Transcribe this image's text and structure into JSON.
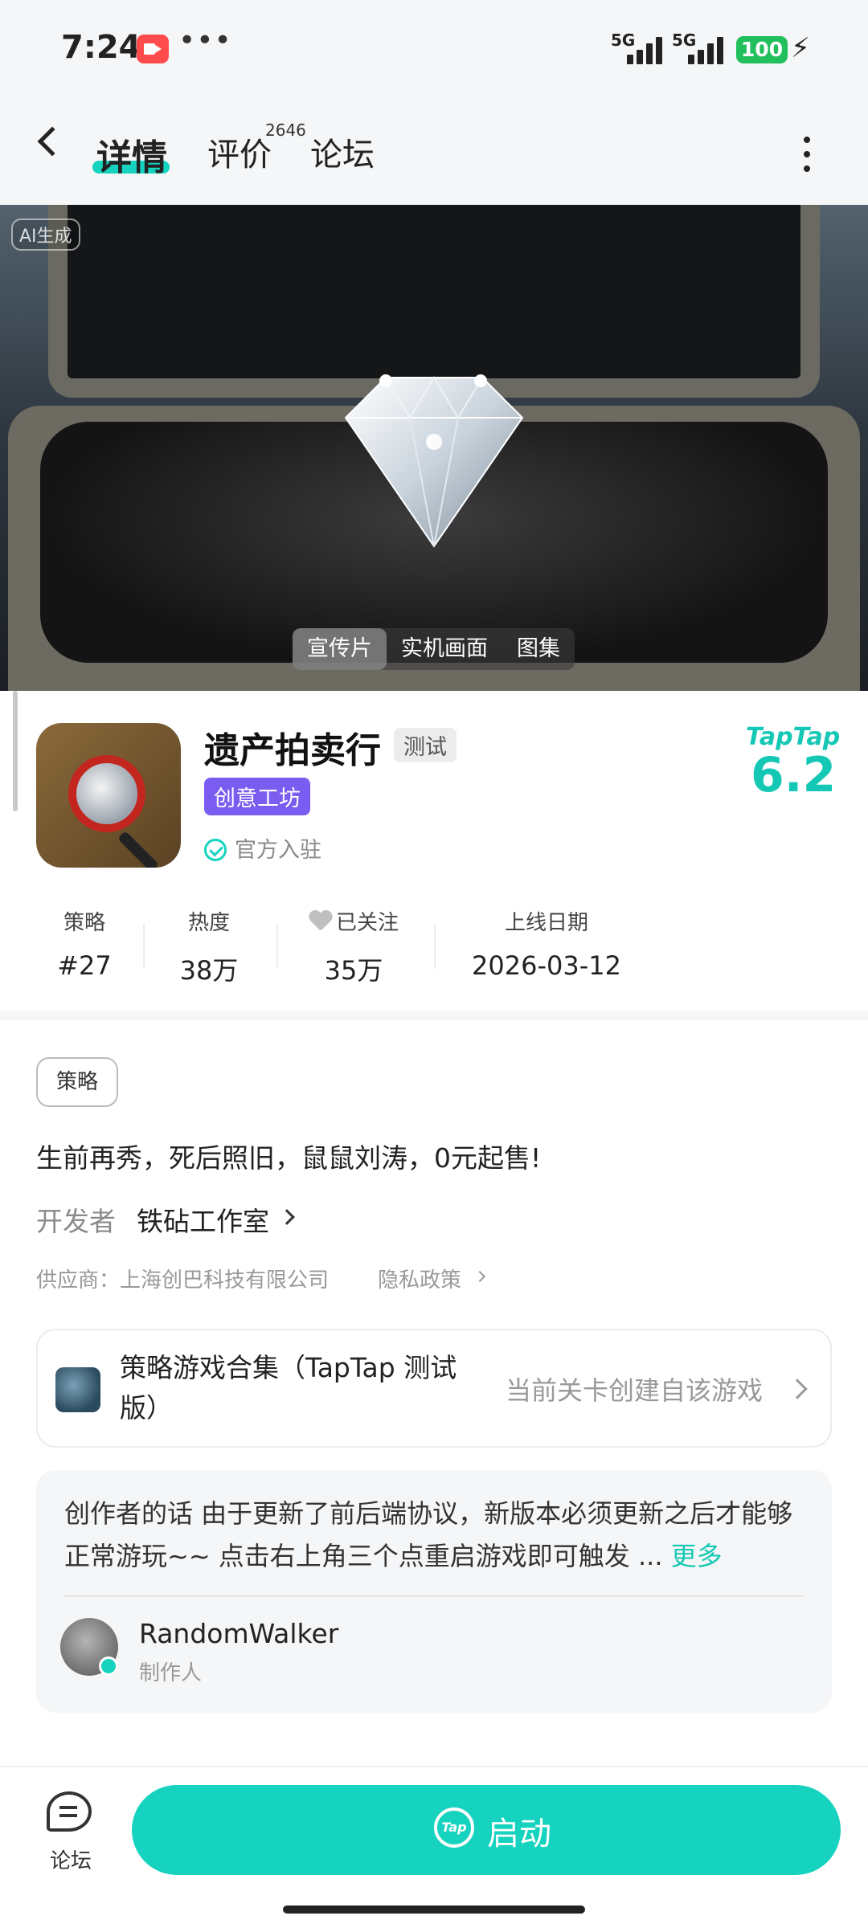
{
  "status_bar": {
    "time": "7:24",
    "network1": "5G",
    "network2": "5G",
    "battery": "100"
  },
  "nav": {
    "detail_tab": "详情",
    "review_tab": "评价",
    "review_count": "2646",
    "forum_tab": "论坛"
  },
  "hero": {
    "ai_tag": "AI生成",
    "media_tabs": [
      "宣传片",
      "实机画面",
      "图集"
    ]
  },
  "app": {
    "title": "遗产拍卖行",
    "test_badge": "测试",
    "creative_tag": "创意工坊",
    "verified": "官方入驻",
    "rating_brand": "TapTap",
    "rating": "6.2"
  },
  "stats": [
    {
      "label": "策略",
      "value": "#27"
    },
    {
      "label": "热度",
      "value": "38万"
    },
    {
      "label": "已关注",
      "value": "35万"
    },
    {
      "label": "上线日期",
      "value": "2026-03-12"
    }
  ],
  "details": {
    "genre": "策略",
    "slogan": "生前再秀，死后照旧，鼠鼠刘涛，0元起售!",
    "developer_label": "开发者",
    "developer": "铁砧工作室",
    "supplier": "供应商：上海创巴科技有限公司",
    "privacy": "隐私政策"
  },
  "collection": {
    "title": "策略游戏合集（TapTap 测试版）",
    "right_text": "当前关卡创建自该游戏"
  },
  "creator": {
    "text": "创作者的话  由于更新了前后端协议，新版本必须更新之后才能够正常游玩~~ 点击右上角三个点重启游戏即可触发 ...",
    "more": "更多",
    "name": "RandomWalker",
    "role": "制作人"
  },
  "bottom": {
    "forum_label": "论坛",
    "launch_logo": "Tap",
    "launch_label": "启动"
  },
  "colors": {
    "accent": "#15d3bf",
    "creative_tag": "#7b5cf0"
  }
}
